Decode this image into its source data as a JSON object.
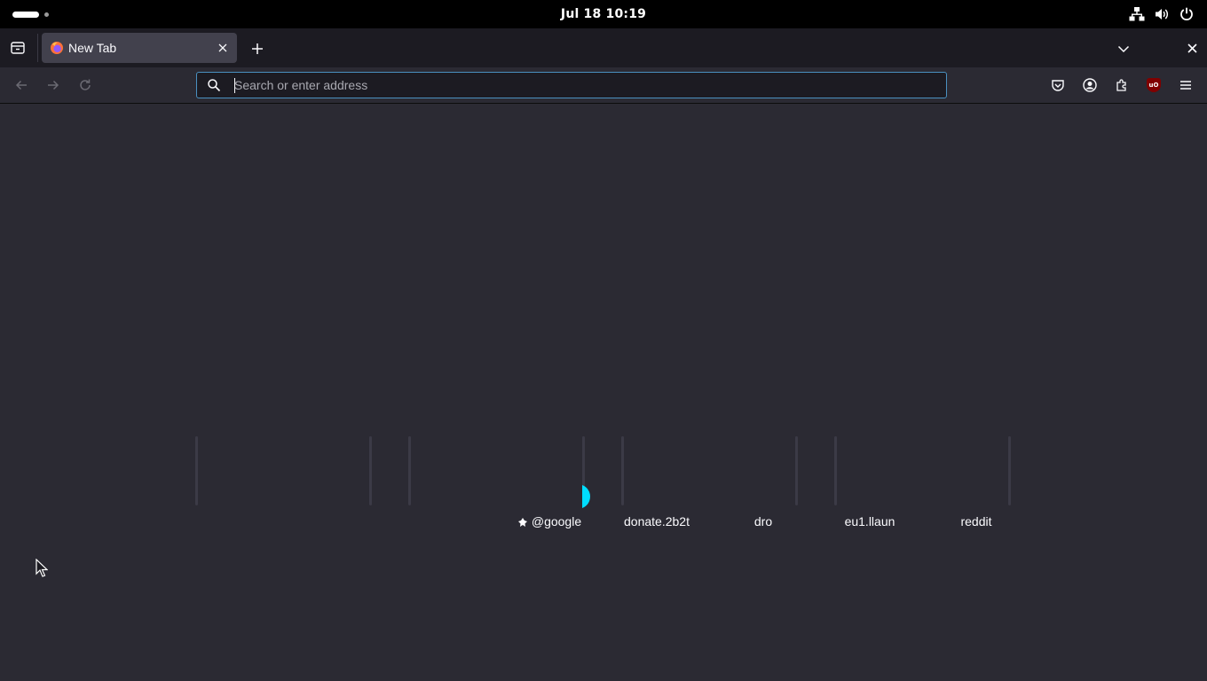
{
  "system_bar": {
    "clock": "Jul 18  10:19",
    "icons": [
      "network-wired-icon",
      "volume-icon",
      "power-icon"
    ]
  },
  "tabs": [
    {
      "title": "New Tab",
      "active": true
    }
  ],
  "toolbar": {
    "search_placeholder": "Search or enter address",
    "search_value": ""
  },
  "top_sites": [
    {
      "label": "@google",
      "pinned": true,
      "loading": true
    },
    {
      "label": "donate.2b2t",
      "pinned": false
    },
    {
      "label": "dro",
      "pinned": false
    },
    {
      "label": "eu1.llaun",
      "pinned": false
    },
    {
      "label": "reddit",
      "pinned": false
    }
  ],
  "colors": {
    "top_bar": "#000000",
    "tab_strip": "#1c1b22",
    "active_tab": "#42414d",
    "content_bg": "#2b2a33",
    "urlbar_bg": "#1c1b22",
    "focus_ring": "#4a90c0",
    "spinner": "#00ddff"
  }
}
